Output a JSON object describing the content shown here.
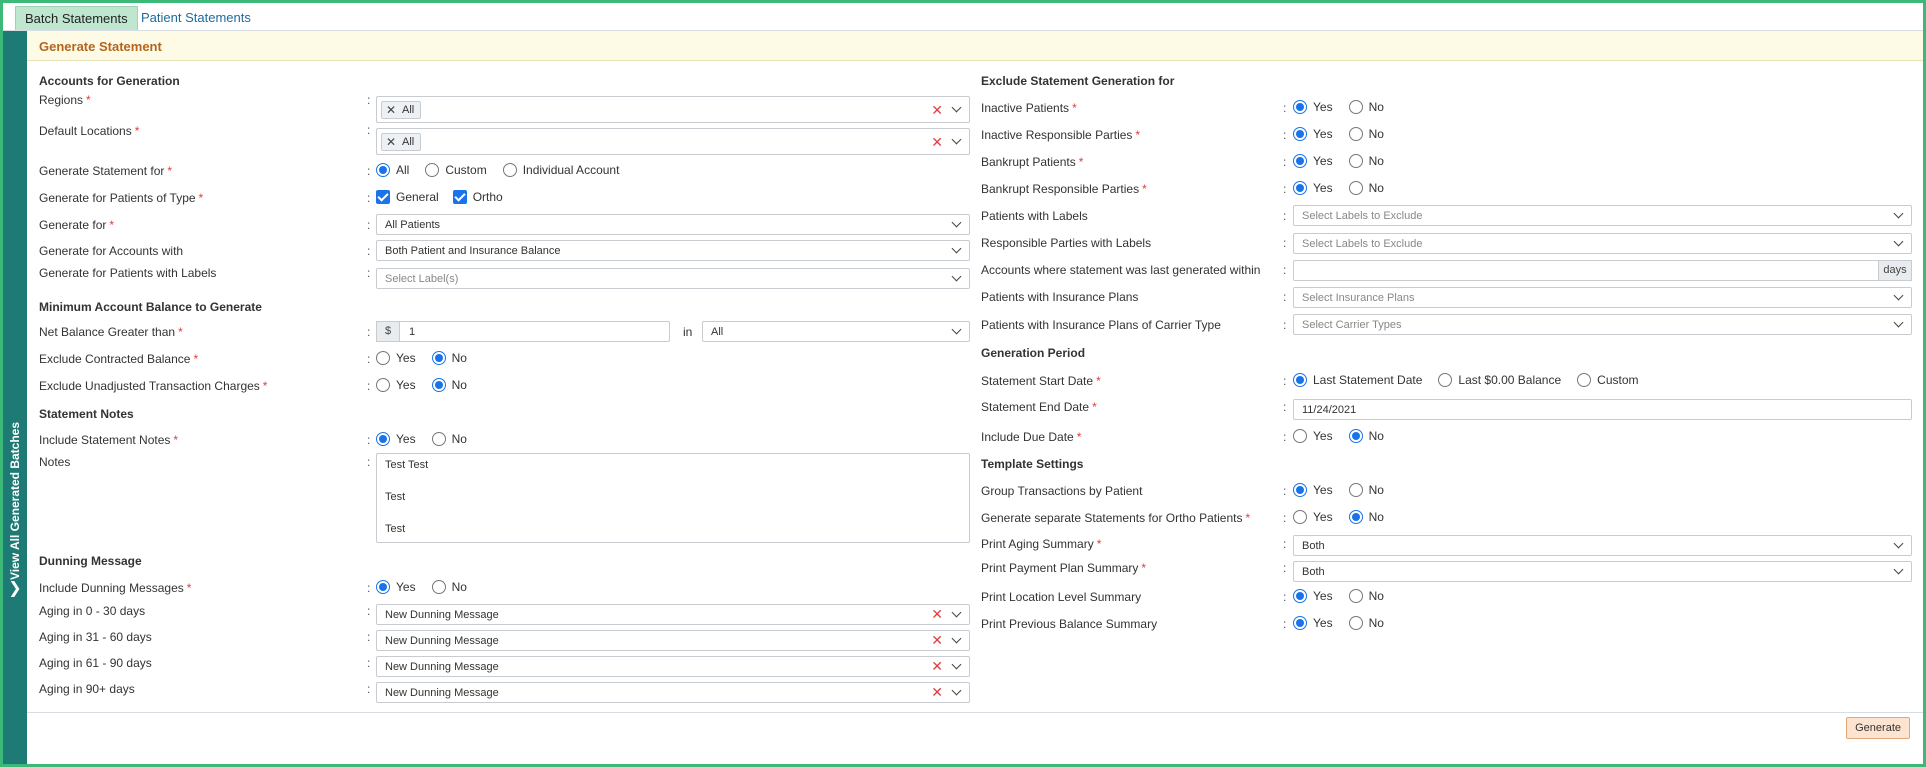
{
  "tabs": [
    "Batch Statements",
    "Patient Statements"
  ],
  "sidebar": {
    "label": "View All Generated Batches"
  },
  "header": {
    "title": "Generate Statement"
  },
  "left": {
    "accounts_section": "Accounts for Generation",
    "regions": {
      "label": "Regions",
      "chip": "All"
    },
    "default_locations": {
      "label": "Default Locations",
      "chip": "All"
    },
    "generate_statement_for": {
      "label": "Generate Statement for",
      "options": [
        "All",
        "Custom",
        "Individual Account"
      ],
      "selected": "All"
    },
    "patients_of_type": {
      "label": "Generate for Patients of Type",
      "options": [
        "General",
        "Ortho"
      ]
    },
    "generate_for": {
      "label": "Generate for",
      "value": "All Patients"
    },
    "accounts_with": {
      "label": "Generate for Accounts with",
      "value": "Both Patient and Insurance Balance"
    },
    "patients_with_labels": {
      "label": "Generate for Patients with Labels",
      "placeholder": "Select Label(s)"
    },
    "min_balance_section": "Minimum Account Balance to Generate",
    "net_balance": {
      "label": "Net Balance Greater than",
      "currency": "$",
      "value": "1",
      "in_label": "in",
      "in_value": "All"
    },
    "exclude_contracted": {
      "label": "Exclude Contracted Balance",
      "options": [
        "Yes",
        "No"
      ],
      "selected": "No"
    },
    "exclude_unadjusted": {
      "label": "Exclude Unadjusted Transaction Charges",
      "options": [
        "Yes",
        "No"
      ],
      "selected": "No"
    },
    "notes_section": "Statement Notes",
    "include_notes": {
      "label": "Include Statement Notes",
      "options": [
        "Yes",
        "No"
      ],
      "selected": "Yes"
    },
    "notes": {
      "label": "Notes",
      "lines": [
        "Test Test",
        "Test",
        "Test"
      ]
    },
    "dunning_section": "Dunning Message",
    "include_dunning": {
      "label": "Include Dunning Messages",
      "options": [
        "Yes",
        "No"
      ],
      "selected": "Yes"
    },
    "aging": [
      {
        "label": "Aging in 0 - 30 days",
        "value": "New Dunning Message"
      },
      {
        "label": "Aging in 31 - 60 days",
        "value": "New Dunning Message"
      },
      {
        "label": "Aging in 61 - 90 days",
        "value": "New Dunning Message"
      },
      {
        "label": "Aging in 90+ days",
        "value": "New Dunning Message"
      }
    ]
  },
  "right": {
    "exclude_section": "Exclude Statement Generation for",
    "inactive_patients": {
      "label": "Inactive Patients",
      "options": [
        "Yes",
        "No"
      ],
      "selected": "Yes"
    },
    "inactive_resp": {
      "label": "Inactive Responsible Parties",
      "options": [
        "Yes",
        "No"
      ],
      "selected": "Yes"
    },
    "bankrupt_patients": {
      "label": "Bankrupt Patients",
      "options": [
        "Yes",
        "No"
      ],
      "selected": "Yes"
    },
    "bankrupt_resp": {
      "label": "Bankrupt Responsible Parties",
      "options": [
        "Yes",
        "No"
      ],
      "selected": "Yes"
    },
    "patients_labels": {
      "label": "Patients with Labels",
      "placeholder": "Select Labels to Exclude"
    },
    "resp_labels": {
      "label": "Responsible Parties with Labels",
      "placeholder": "Select Labels to Exclude"
    },
    "last_generated": {
      "label": "Accounts where statement was last generated within",
      "unit": "days"
    },
    "insurance_plans": {
      "label": "Patients with Insurance Plans",
      "placeholder": "Select Insurance Plans"
    },
    "carrier_type": {
      "label": "Patients with Insurance Plans of Carrier Type",
      "placeholder": "Select Carrier Types"
    },
    "period_section": "Generation Period",
    "start_date": {
      "label": "Statement Start Date",
      "options": [
        "Last Statement Date",
        "Last $0.00 Balance",
        "Custom"
      ],
      "selected": "Last Statement Date"
    },
    "end_date": {
      "label": "Statement End Date",
      "value": "11/24/2021"
    },
    "due_date": {
      "label": "Include Due Date",
      "options": [
        "Yes",
        "No"
      ],
      "selected": "No"
    },
    "template_section": "Template Settings",
    "group_tx": {
      "label": "Group Transactions by Patient",
      "options": [
        "Yes",
        "No"
      ],
      "selected": "Yes"
    },
    "separate_ortho": {
      "label": "Generate separate Statements for Ortho Patients",
      "options": [
        "Yes",
        "No"
      ],
      "selected": "No"
    },
    "aging_summary": {
      "label": "Print Aging Summary",
      "value": "Both"
    },
    "payment_plan": {
      "label": "Print Payment Plan Summary",
      "value": "Both"
    },
    "location_summary": {
      "label": "Print Location Level Summary",
      "options": [
        "Yes",
        "No"
      ],
      "selected": "Yes"
    },
    "prev_balance": {
      "label": "Print Previous Balance Summary",
      "options": [
        "Yes",
        "No"
      ],
      "selected": "Yes"
    }
  },
  "footer": {
    "generate_label": "Generate"
  }
}
